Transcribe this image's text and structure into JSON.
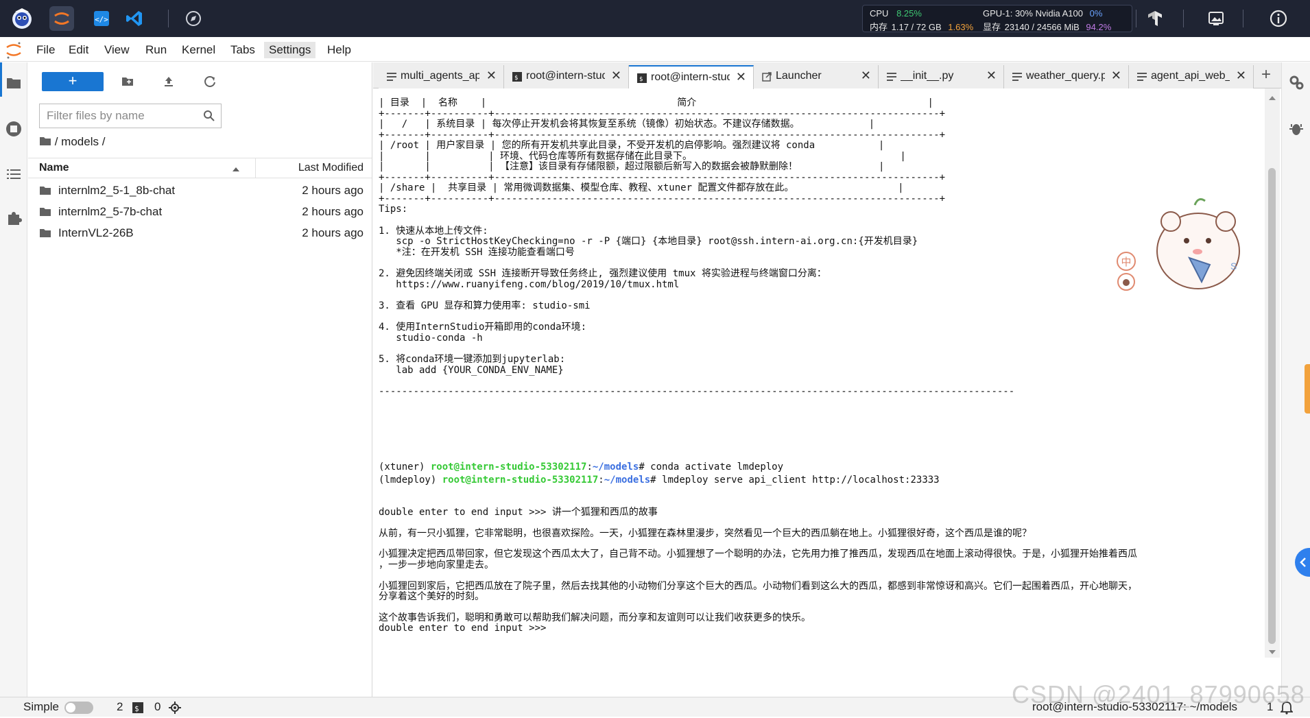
{
  "topbar": {
    "icons": [
      "intern-mascot-icon",
      "jupyter-icon",
      "code-editor-icon",
      "vscode-icon",
      "compass-icon"
    ],
    "right_icons": [
      "tensorboard-icon",
      "image-gallery-icon",
      "info-icon"
    ],
    "resources": {
      "cpu_label": "CPU",
      "cpu_value": "8.25%",
      "mem_label": "内存",
      "mem_used": "1.17 / 72 GB",
      "mem_pct": "1.63%",
      "gpu_label": "GPU-1: 30% Nvidia A100",
      "gpu_util": "0%",
      "vram_label": "显存",
      "vram_used": "23140 / 24566 MiB",
      "vram_pct": "94.2%"
    }
  },
  "menu": {
    "items": [
      "File",
      "Edit",
      "View",
      "Run",
      "Kernel",
      "Tabs",
      "Settings",
      "Help"
    ],
    "active": "Settings"
  },
  "leftbar": {
    "icons": [
      "folder-icon",
      "running-icon",
      "toc-icon",
      "extension-icon"
    ]
  },
  "filebrowser": {
    "new_label": "+",
    "filter_placeholder": "Filter files by name",
    "breadcrumb": "/ models /",
    "col_name": "Name",
    "col_modified": "Last Modified",
    "rows": [
      {
        "name": "internlm2_5-1_8b-chat",
        "modified": "2 hours ago"
      },
      {
        "name": "internlm2_5-7b-chat",
        "modified": "2 hours ago"
      },
      {
        "name": "InternVL2-26B",
        "modified": "2 hours ago"
      }
    ]
  },
  "tabs": [
    {
      "label": "multi_agents_api",
      "icon": "document-icon",
      "active": false
    },
    {
      "label": "root@intern-studio",
      "icon": "terminal-icon",
      "active": false
    },
    {
      "label": "root@intern-studio",
      "icon": "terminal-icon",
      "active": true
    },
    {
      "label": "Launcher",
      "icon": "launcher-icon",
      "active": false
    },
    {
      "label": "__init__.py",
      "icon": "document-icon",
      "active": false
    },
    {
      "label": "weather_query.py",
      "icon": "document-icon",
      "active": false
    },
    {
      "label": "agent_api_web_demo",
      "icon": "document-icon",
      "active": false
    }
  ],
  "tab_add": "+",
  "terminal": {
    "lines": [
      "| 目录  |  名称    |                                 简介                                        |",
      "+-------+----------+-----------------------------------------------------------------------------+",
      "|   /   | 系统目录 | 每次停止开发机会将其恢复至系统（镜像）初始状态。不建议存储数据。            |",
      "+-------+----------+-----------------------------------------------------------------------------+",
      "| /root | 用户家目录 | 您的所有开发机共享此目录，不受开发机的启停影响。强烈建议将 conda           |",
      "|       |          | 环境、代码仓库等所有数据存储在此目录下。                                    |",
      "|       |          | 【注意】该目录有存储限额，超过限额后新写入的数据会被静默删除！              |",
      "+-------+----------+-----------------------------------------------------------------------------+",
      "| /share |  共享目录 | 常用微调数据集、模型仓库、教程、xtuner 配置文件都存放在此。                  |",
      "+-------+----------+-----------------------------------------------------------------------------+",
      "Tips:",
      "",
      "1. 快速从本地上传文件:",
      "   scp -o StrictHostKeyChecking=no -r -P {端口} {本地目录} root@ssh.intern-ai.org.cn:{开发机目录}",
      "   *注：在开发机 SSH 连接功能查看端口号",
      "",
      "2. 避免因终端关闭或 SSH 连接断开导致任务终止, 强烈建议使用 tmux 将实验进程与终端窗口分离：",
      "   https://www.ruanyifeng.com/blog/2019/10/tmux.html",
      "",
      "3. 查看 GPU 显存和算力使用率: studio-smi",
      "",
      "4. 使用InternStudio开箱即用的conda环境:",
      "   studio-conda -h",
      "",
      "5. 将conda环境一键添加到jupyterlab:",
      "   lab add {YOUR_CONDA_ENV_NAME}",
      "",
      "--------------------------------------------------------------------------------------------------------------",
      "",
      "",
      "",
      "double enter to end input >>> 讲一个狐狸和西瓜的故事",
      "",
      "从前，有一只小狐狸，它非常聪明，也很喜欢探险。一天，小狐狸在森林里漫步，突然看见一个巨大的西瓜躺在地上。小狐狸很好奇，这个西瓜是谁的呢？",
      "",
      "小狐狸决定把西瓜带回家，但它发现这个西瓜太大了，自己背不动。小狐狸想了一个聪明的办法，它先用力推了推西瓜，发现西瓜在地面上滚动得很快。于是，小狐狸开始推着西瓜",
      "，一步一步地向家里走去。",
      "",
      "小狐狸回到家后，它把西瓜放在了院子里，然后去找其他的小动物们分享这个巨大的西瓜。小动物们看到这么大的西瓜，都感到非常惊讶和高兴。它们一起围着西瓜，开心地聊天，",
      "分享着这个美好的时刻。",
      "",
      "这个故事告诉我们，聪明和勇敢可以帮助我们解决问题，而分享和友谊则可以让我们收获更多的快乐。",
      "double enter to end input >>>"
    ],
    "prompt1_env": "(xtuner) ",
    "prompt1_user": "root@intern-studio-53302117",
    "prompt1_sep": ":",
    "prompt1_path": "~/models",
    "prompt1_cmd": "# conda activate lmdeploy",
    "prompt2_env": "(lmdeploy) ",
    "prompt2_user": "root@intern-studio-53302117",
    "prompt2_sep": ":",
    "prompt2_path": "~/models",
    "prompt2_cmd": "# lmdeploy serve api_client http://localhost:23333",
    "sticker_char1": "中",
    "sticker_char2": "S"
  },
  "rightbar": {
    "icons": [
      "property-inspector-icon",
      "debugger-icon"
    ]
  },
  "statusbar": {
    "mode_label": "Simple",
    "terminals_count": "2",
    "kernels_count": "0",
    "path": "root@intern-studio-53302117: ~/models",
    "notifications": "1"
  },
  "watermark": "CSDN @2401_87990658"
}
